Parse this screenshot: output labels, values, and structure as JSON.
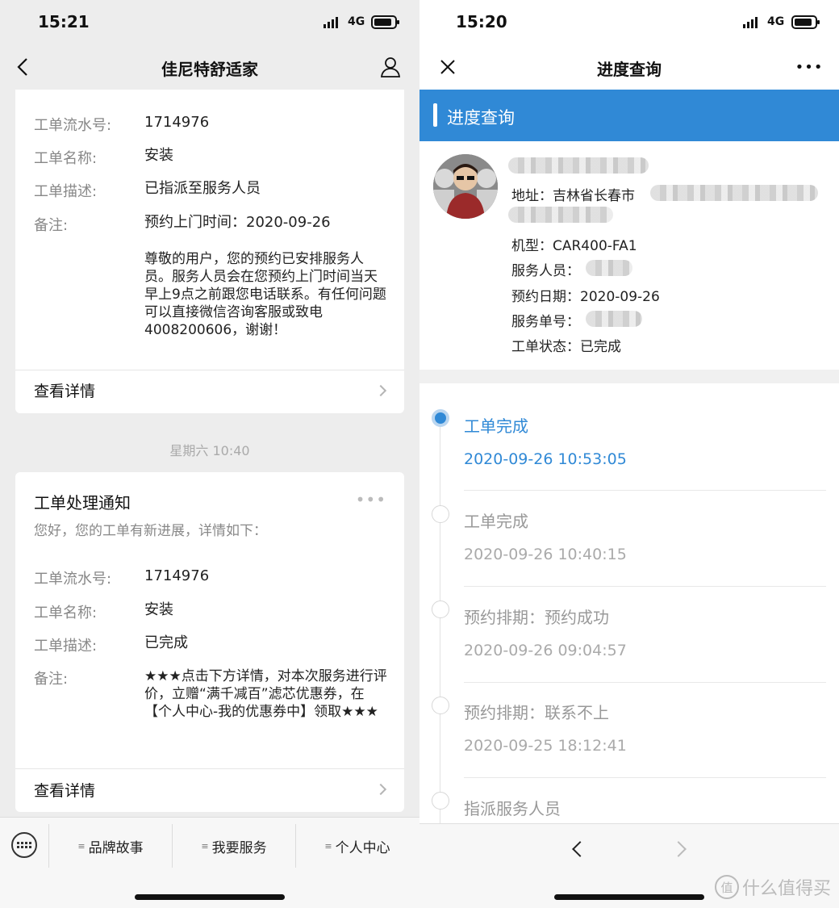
{
  "left": {
    "status": {
      "time": "15:21",
      "network": "4G"
    },
    "nav": {
      "title": "佳尼特舒适家"
    },
    "card1": {
      "rows": [
        {
          "key": "工单流水号:",
          "value": "1714976"
        },
        {
          "key": "工单名称:",
          "value": "安装"
        },
        {
          "key": "工单描述:",
          "value": "已指派至服务人员"
        },
        {
          "key": "备注:",
          "value": "预约上门时间：2020-09-26"
        }
      ],
      "note": "尊敬的用户，您的预约已安排服务人员。服务人员会在您预约上门时间当天早上9点之前跟您电话联系。有任何问题可以直接微信咨询客服或致电 4008200606，谢谢！",
      "detail_label": "查看详情"
    },
    "timestamp": "星期六 10:40",
    "card2": {
      "title": "工单处理通知",
      "subtitle": "您好，您的工单有新进展，详情如下：",
      "rows": [
        {
          "key": "工单流水号:",
          "value": "1714976"
        },
        {
          "key": "工单名称:",
          "value": "安装"
        },
        {
          "key": "工单描述:",
          "value": "已完成"
        },
        {
          "key": "备注:",
          "value": "★★★点击下方详情，对本次服务进行评价，立赠“满千减百”滤芯优惠券，在【个人中心-我的优惠券中】领取★★★"
        }
      ],
      "detail_label": "查看详情"
    },
    "menu": [
      "品牌故事",
      "我要服务",
      "个人中心"
    ]
  },
  "right": {
    "status": {
      "time": "15:20",
      "network": "4G"
    },
    "nav": {
      "title": "进度查询"
    },
    "banner": "进度查询",
    "info": {
      "address_label": "地址：吉林省长春市",
      "model": "机型：CAR400-FA1",
      "staff": "服务人员：",
      "date": "预约日期：2020-09-26",
      "order_no": "服务单号：",
      "status": "工单状态：已完成"
    },
    "timeline": [
      {
        "title": "工单完成",
        "time": "2020-09-26 10:53:05",
        "active": true
      },
      {
        "title": "工单完成",
        "time": "2020-09-26 10:40:15",
        "active": false
      },
      {
        "title": "预约排期：预约成功",
        "time": "2020-09-26 09:04:57",
        "active": false
      },
      {
        "title": "预约排期：联系不上",
        "time": "2020-09-25 18:12:41",
        "active": false
      },
      {
        "title": "指派服务人员",
        "time": "",
        "active": false
      }
    ],
    "watermark": "什么值得买",
    "watermark_badge": "值"
  },
  "colors": {
    "accent": "#3089d6",
    "background": "#ededed"
  }
}
